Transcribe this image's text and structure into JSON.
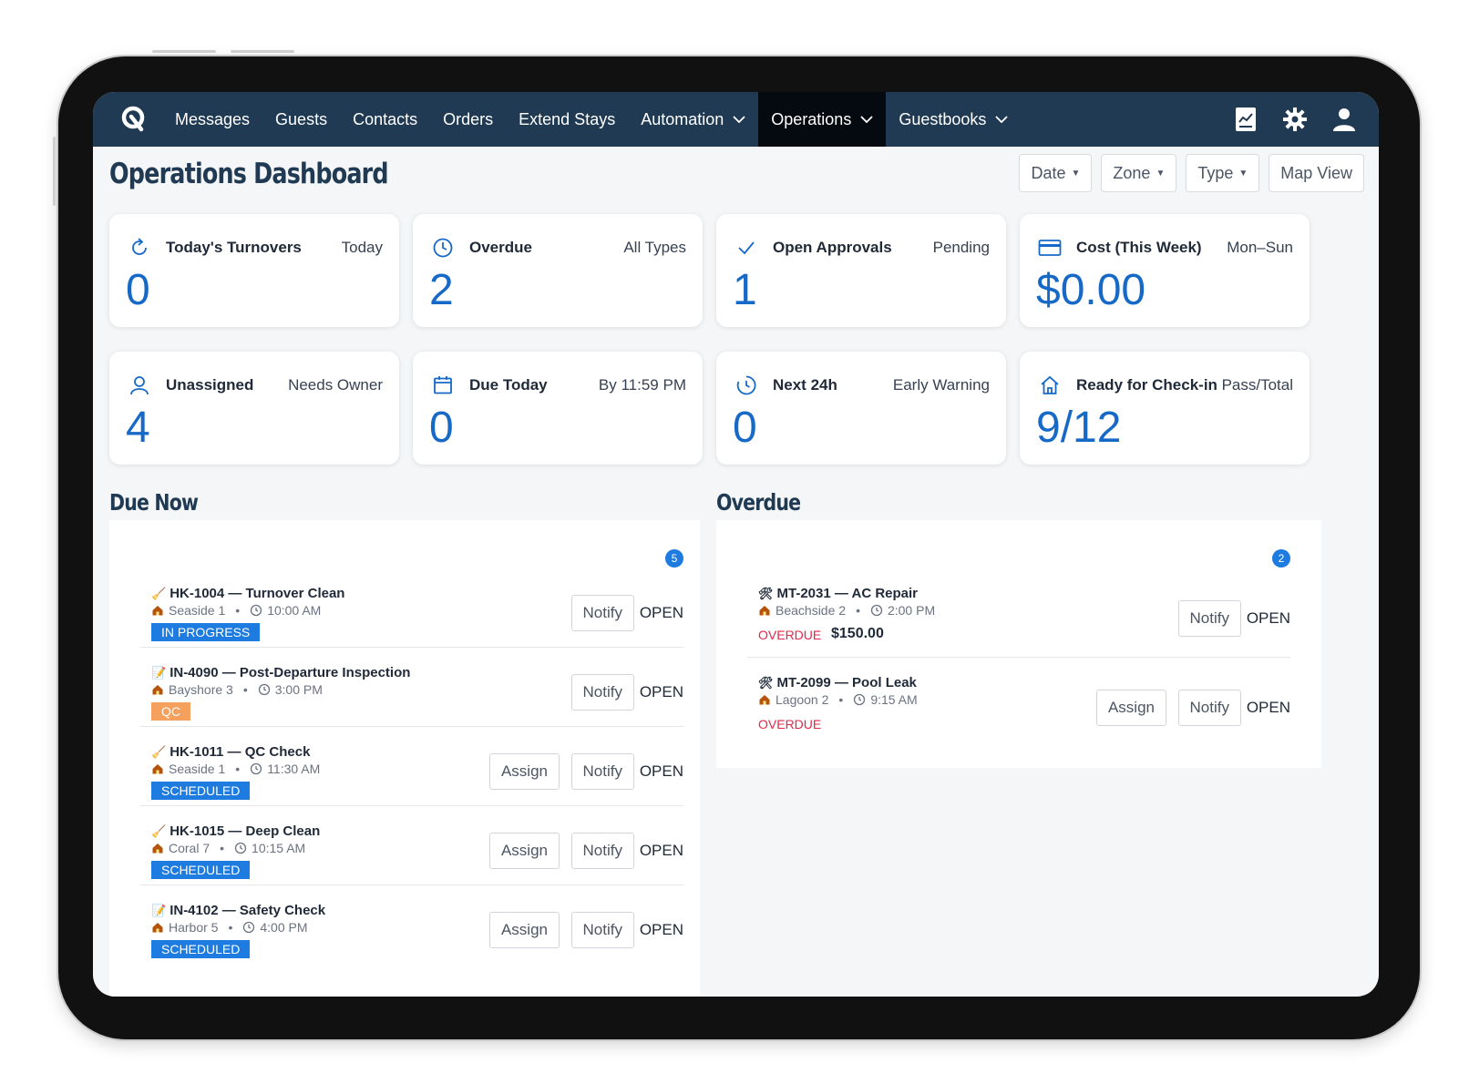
{
  "nav": {
    "items": [
      {
        "label": "Messages",
        "dropdown": false,
        "active": false
      },
      {
        "label": "Guests",
        "dropdown": false,
        "active": false
      },
      {
        "label": "Contacts",
        "dropdown": false,
        "active": false
      },
      {
        "label": "Orders",
        "dropdown": false,
        "active": false
      },
      {
        "label": "Extend Stays",
        "dropdown": false,
        "active": false
      },
      {
        "label": "Automation",
        "dropdown": true,
        "active": false
      },
      {
        "label": "Operations",
        "dropdown": true,
        "active": true
      },
      {
        "label": "Guestbooks",
        "dropdown": true,
        "active": false
      }
    ],
    "icons": [
      "report-icon",
      "gear-icon",
      "user-icon"
    ]
  },
  "header": {
    "title": "Operations Dashboard",
    "filters": [
      "Date",
      "Zone",
      "Type"
    ],
    "map_view": "Map View"
  },
  "stats": [
    {
      "icon": "refresh-icon",
      "title": "Today's Turnovers",
      "sub": "Today",
      "value": "0"
    },
    {
      "icon": "clock-icon",
      "title": "Overdue",
      "sub": "All Types",
      "value": "2"
    },
    {
      "icon": "check-icon",
      "title": "Open Approvals",
      "sub": "Pending",
      "value": "1"
    },
    {
      "icon": "credit-card-icon",
      "title": "Cost (This Week)",
      "sub": "Mon–Sun",
      "value": "$0.00"
    },
    {
      "icon": "user-icon",
      "title": "Unassigned",
      "sub": "Needs Owner",
      "value": "4"
    },
    {
      "icon": "calendar-icon",
      "title": "Due Today",
      "sub": "By 11:59 PM",
      "value": "0"
    },
    {
      "icon": "history-icon",
      "title": "Next 24h",
      "sub": "Early Warning",
      "value": "0"
    },
    {
      "icon": "home-icon",
      "title": "Ready for Check-in",
      "sub": "Pass/Total",
      "value": "9/12"
    }
  ],
  "due_now": {
    "title": "Due Now",
    "count": "5",
    "tasks": [
      {
        "icon": "broom-icon",
        "title": "HK-1004 — Turnover Clean",
        "location": "Seaside 1",
        "time": "10:00 AM",
        "status": "IN PROGRESS",
        "status_type": "progress",
        "assign": false
      },
      {
        "icon": "memo-icon",
        "title": "IN-4090 — Post-Departure Inspection",
        "location": "Bayshore 3",
        "time": "3:00 PM",
        "status": "QC",
        "status_type": "qc",
        "assign": false
      },
      {
        "icon": "broom-icon",
        "title": "HK-1011 — QC Check",
        "location": "Seaside 1",
        "time": "11:30 AM",
        "status": "SCHEDULED",
        "status_type": "sched",
        "assign": true
      },
      {
        "icon": "broom-icon",
        "title": "HK-1015 — Deep Clean",
        "location": "Coral 7",
        "time": "10:15 AM",
        "status": "SCHEDULED",
        "status_type": "sched",
        "assign": true
      },
      {
        "icon": "memo-icon",
        "title": "IN-4102 — Safety Check",
        "location": "Harbor 5",
        "time": "4:00 PM",
        "status": "SCHEDULED",
        "status_type": "sched",
        "assign": true
      }
    ]
  },
  "overdue": {
    "title": "Overdue",
    "count": "2",
    "tasks": [
      {
        "icon": "tools-icon",
        "title": "MT-2031 — AC Repair",
        "location": "Beachside 2",
        "time": "2:00 PM",
        "status": "OVERDUE",
        "amount": "$150.00",
        "assign": false
      },
      {
        "icon": "tools-icon",
        "title": "MT-2099 — Pool Leak",
        "location": "Lagoon 2",
        "time": "9:15 AM",
        "status": "OVERDUE",
        "amount": "",
        "assign": true
      }
    ]
  },
  "actions": {
    "assign": "Assign",
    "notify": "Notify",
    "open": "OPEN"
  },
  "colors": {
    "nav_bg": "#1f3a52",
    "nav_active": "#050a10",
    "accent": "#1769c7",
    "badge": "#1e7be0",
    "qc": "#f5a05c",
    "overdue": "#e0284a"
  }
}
